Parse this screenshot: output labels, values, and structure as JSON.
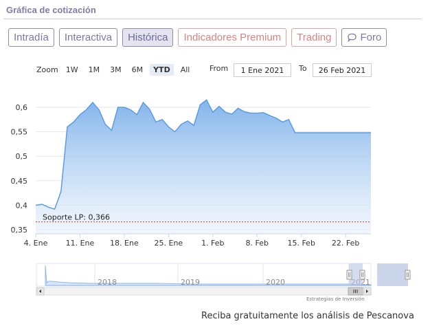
{
  "header": {
    "title": "Gráfica de cotización"
  },
  "tabs": [
    {
      "label": "Intradía",
      "active": false,
      "premium": false
    },
    {
      "label": "Interactiva",
      "active": false,
      "premium": false
    },
    {
      "label": "Histórica",
      "active": true,
      "premium": false
    },
    {
      "label": "Indicadores Premium",
      "active": false,
      "premium": true
    },
    {
      "label": "Trading",
      "active": false,
      "premium": true
    },
    {
      "label": "Foro",
      "active": false,
      "premium": false,
      "icon": "chat-bubble-icon"
    }
  ],
  "zoom": {
    "label": "Zoom",
    "options": [
      "1W",
      "1M",
      "3M",
      "6M",
      "YTD",
      "All"
    ],
    "selected": "YTD"
  },
  "range": {
    "from_label": "From",
    "from_value": "1 Ene 2021",
    "to_label": "To",
    "to_value": "26 Feb 2021"
  },
  "chart_data": {
    "type": "area",
    "ylim": [
      0.35,
      0.62
    ],
    "yticks": [
      0.35,
      0.4,
      0.45,
      0.5,
      0.55,
      0.6
    ],
    "ytick_labels": [
      "0,35",
      "0,4",
      "0,45",
      "0,5",
      "0,55",
      "0,6"
    ],
    "xticks": [
      {
        "day": 3,
        "label": "4. Ene"
      },
      {
        "day": 10,
        "label": "11. Ene"
      },
      {
        "day": 17,
        "label": "18. Ene"
      },
      {
        "day": 24,
        "label": "25. Ene"
      },
      {
        "day": 31,
        "label": "1. Feb"
      },
      {
        "day": 38,
        "label": "8. Feb"
      },
      {
        "day": 45,
        "label": "15. Feb"
      },
      {
        "day": 52,
        "label": "22. Feb"
      }
    ],
    "xlim": [
      3,
      56
    ],
    "x": [
      3,
      4,
      5,
      6,
      7,
      8,
      9,
      10,
      11,
      12,
      13,
      14,
      15,
      16,
      17,
      18,
      19,
      20,
      21,
      22,
      23,
      24,
      25,
      26,
      27,
      28,
      29,
      30,
      31,
      32,
      33,
      34,
      35,
      36,
      37,
      38,
      39,
      40,
      41,
      42,
      43,
      44,
      45,
      46,
      47,
      48,
      49,
      50,
      51,
      52,
      53,
      54,
      55,
      56
    ],
    "series": [
      {
        "values": [
          0.4,
          0.402,
          0.396,
          0.392,
          0.428,
          0.56,
          0.57,
          0.585,
          0.595,
          0.61,
          0.595,
          0.565,
          0.553,
          0.6,
          0.6,
          0.595,
          0.585,
          0.61,
          0.596,
          0.57,
          0.575,
          0.56,
          0.55,
          0.565,
          0.572,
          0.563,
          0.605,
          0.615,
          0.59,
          0.602,
          0.59,
          0.586,
          0.598,
          0.591,
          0.588,
          0.588,
          0.589,
          0.583,
          0.578,
          0.57,
          0.575,
          0.548,
          0.548,
          0.548,
          0.548,
          0.548,
          0.548,
          0.548,
          0.548,
          0.548,
          0.548,
          0.548,
          0.548,
          0.548
        ]
      }
    ],
    "annotation": {
      "label": "Soporte LP: 0,366",
      "value": 0.366
    },
    "navigator": {
      "year_labels": [
        "2018",
        "2019",
        "2020",
        "2021"
      ]
    },
    "credits": "Estrategias de Inversión"
  },
  "footer": {
    "text": "Reciba gratuitamente los análisis de Pescanova"
  }
}
